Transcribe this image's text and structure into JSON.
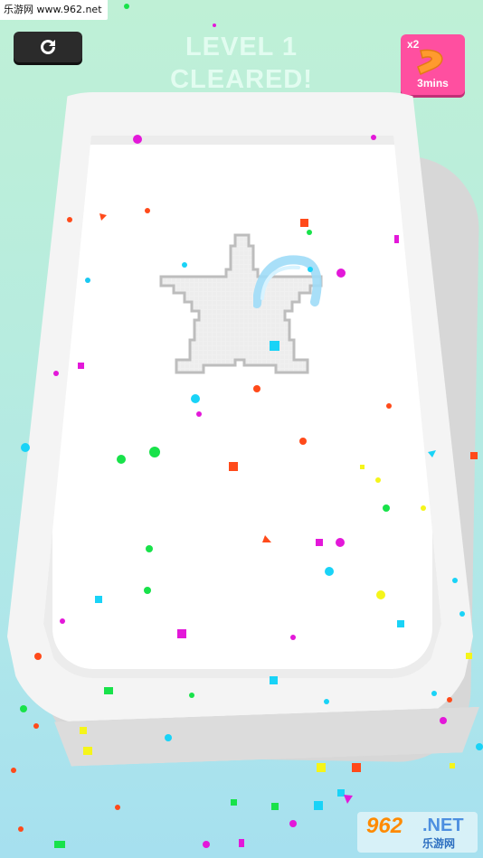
{
  "watermark_top": "乐游网 www.962.net",
  "restart_icon": "restart-icon",
  "title_line1": "LEVEL 1",
  "title_line2": "CLEARED!",
  "bonus": {
    "multiplier": "x2",
    "icon": "magnet-icon",
    "duration": "3mins"
  },
  "watermark_bottom": {
    "number": "962",
    "domain": ".NET",
    "subtitle": "乐游网"
  },
  "colors": {
    "accent_pink": "#ff4fa0",
    "restart_bg": "#2b2b2b",
    "tool_blue": "#8fd6f5",
    "magnet_orange": "#ff9a2e"
  }
}
